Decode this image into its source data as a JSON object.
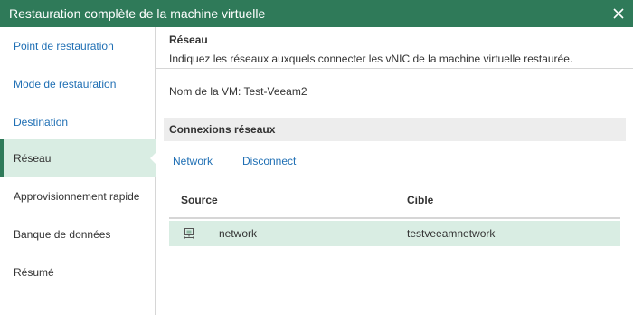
{
  "window": {
    "title": "Restauration complète de la machine virtuelle"
  },
  "sidebar": {
    "items": [
      {
        "label": "Point de restauration",
        "state": "done"
      },
      {
        "label": "Mode de restauration",
        "state": "done"
      },
      {
        "label": "Destination",
        "state": "done"
      },
      {
        "label": "Réseau",
        "state": "active"
      },
      {
        "label": "Approvisionnement rapide",
        "state": "pending"
      },
      {
        "label": "Banque de données",
        "state": "pending"
      },
      {
        "label": "Résumé",
        "state": "pending"
      }
    ]
  },
  "header": {
    "title": "Réseau",
    "description": "Indiquez les réseaux auxquels connecter les vNIC de la machine virtuelle restaurée."
  },
  "vm": {
    "name_text": "Nom de la VM: Test-Veeam2"
  },
  "network_section": {
    "title": "Connexions réseaux",
    "network_link": "Network",
    "disconnect_link": "Disconnect"
  },
  "table": {
    "headers": {
      "source": "Source",
      "target": "Cible"
    },
    "rows": [
      {
        "icon": "network-adapter-icon",
        "source": "network",
        "target": "testveeamnetwork"
      }
    ]
  },
  "colors": {
    "titlebar": "#2f7a59",
    "active_step_bg": "#d9ede3",
    "link": "#1f6fb4",
    "section_bg": "#ededed"
  }
}
